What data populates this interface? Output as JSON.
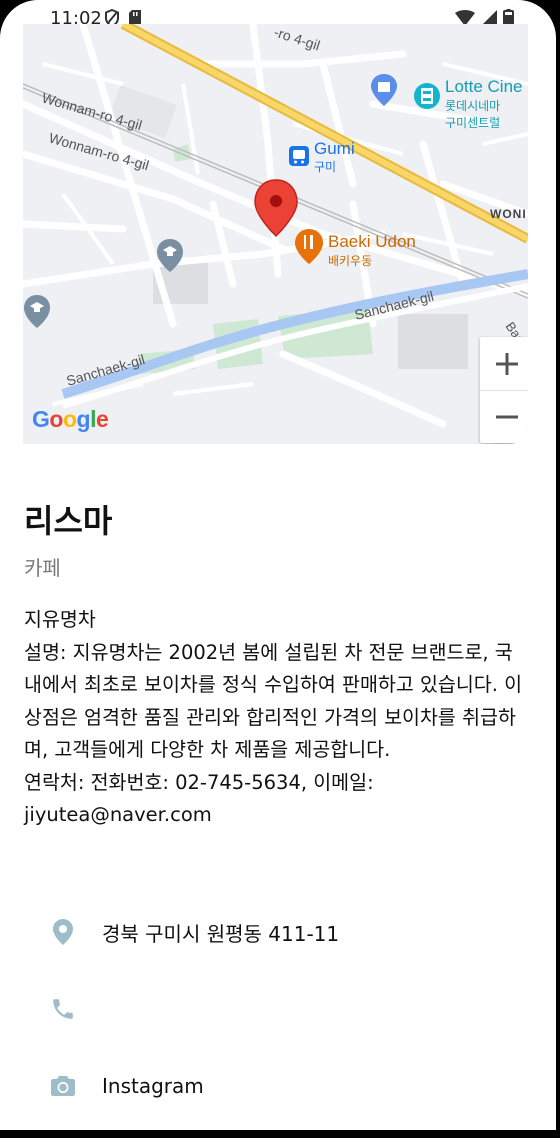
{
  "status_bar": {
    "time": "11:02"
  },
  "map": {
    "zoom_in_label": "+",
    "zoom_out_label": "−",
    "labels": {
      "road_top": "-ro 4-gil",
      "wonnam1": "Wonnam-ro 4-gil",
      "wonnam2": "Wonnam-ro 4-gil",
      "gumi_en": "Gumi",
      "gumi_ko": "구미",
      "lotte_en": "Lotte Cine",
      "lotte_ko1": "롯데시네마 ",
      "lotte_ko2": "구미센트럴",
      "baeki_en": "Baeki Udon",
      "baeki_ko": "배키우동",
      "woni": "WONI",
      "sanchaek1": "Sanchaek-gil",
      "sanchaek2": "Sanchaek-gil",
      "baeks": "Baeks",
      "google": [
        "G",
        "o",
        "o",
        "g",
        "l",
        "e"
      ]
    },
    "colors": {
      "pin": "#ea4335",
      "highway": "#f7c44a",
      "river": "#a8c7f2",
      "park": "#d3ebd6",
      "transit": "#1a73e8",
      "food": "#e8710a",
      "cinema": "#12b5cb"
    }
  },
  "place": {
    "name": "리스마",
    "category": "카페",
    "description": "지유명차\n설명: 지유명차는 2002년 봄에 설립된 차 전문 브랜드로, 국내에서 최초로 보이차를 정식 수입하여 판매하고 있습니다. 이 상점은 엄격한 품질 관리와 합리적인 가격의 보이차를 취급하며, 고객들에게 다양한 차 제품을 제공합니다.\n연락처: 전화번호: 02-745-5634, 이메일: jiyutea@naver.com"
  },
  "info": {
    "address": "경북 구미시 원평동 411-11",
    "phone": "",
    "instagram": "Instagram",
    "icon_color": "#9fbcc9"
  }
}
